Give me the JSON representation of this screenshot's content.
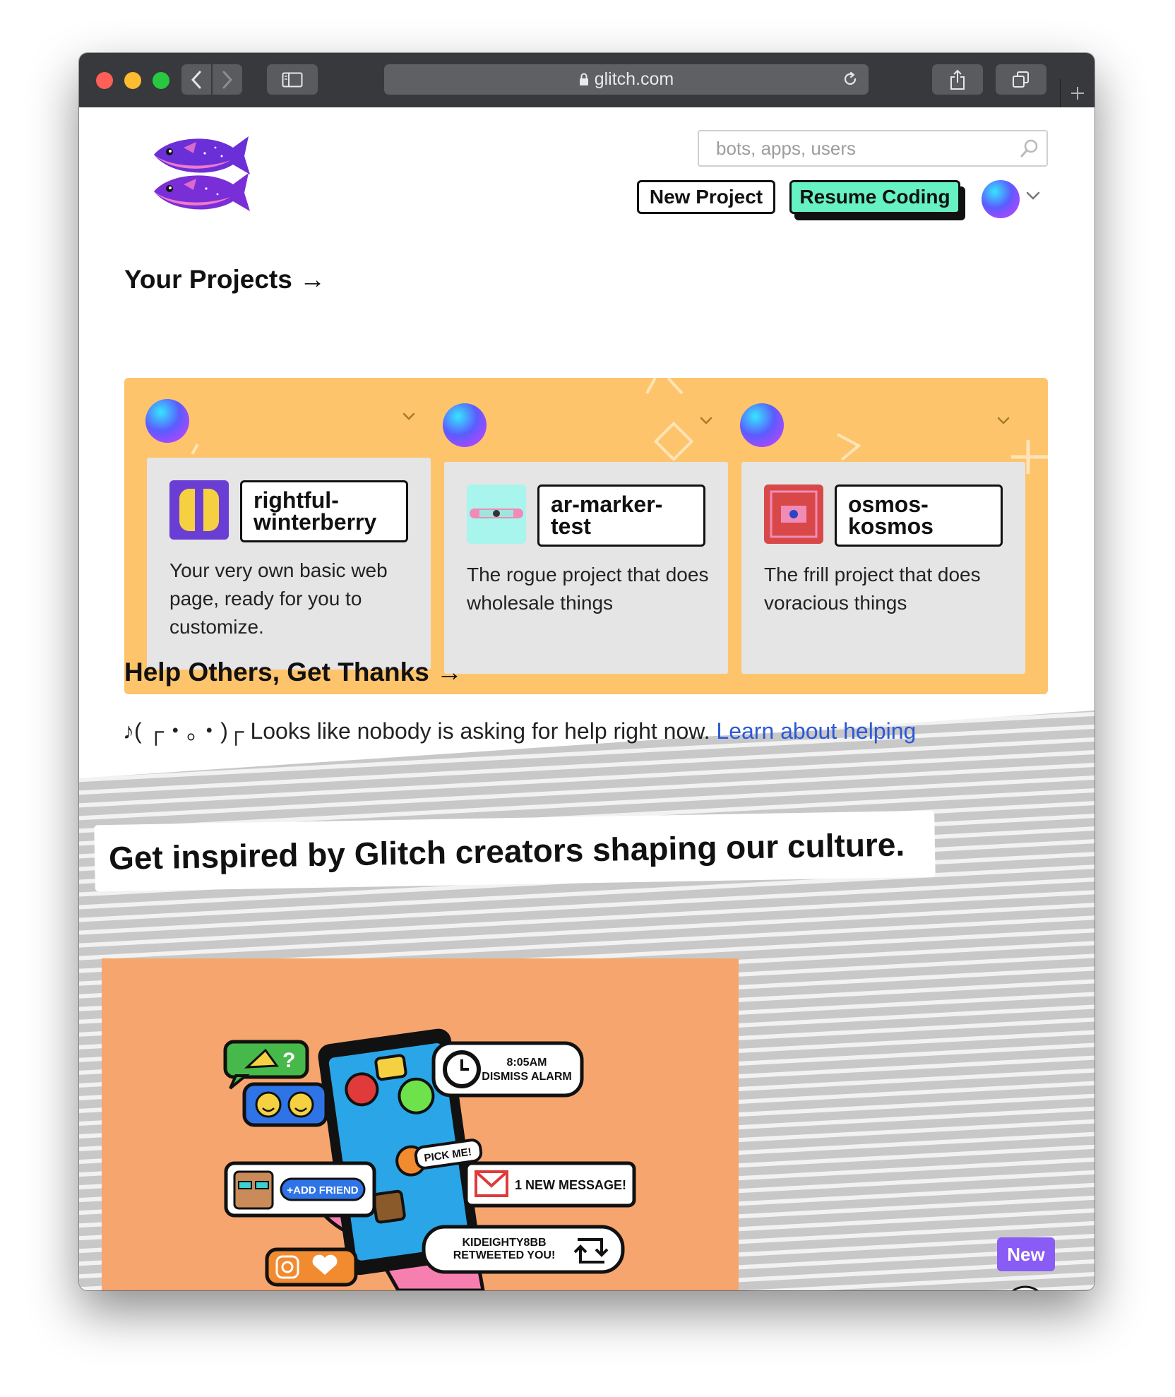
{
  "browser": {
    "url": "glitch.com"
  },
  "header": {
    "search_placeholder": "bots, apps, users",
    "new_project_label": "New Project",
    "resume_coding_label": "Resume Coding"
  },
  "projects_section": {
    "title": "Your Projects →",
    "cards": [
      {
        "name_line1": "rightful-",
        "name_line2": "winterberry",
        "description": "Your very own basic web page, ready for you to customize."
      },
      {
        "name_line1": "ar-marker-",
        "name_line2": "test",
        "description": "The rogue project that does wholesale things"
      },
      {
        "name_line1": "osmos-",
        "name_line2": "kosmos",
        "description": "The frill project that does voracious things"
      }
    ]
  },
  "help_section": {
    "title": "Help Others, Get Thanks →",
    "message": "♪( ┌・。・)┌ Looks like nobody is asking for help right now.",
    "link_label": "Learn about helping"
  },
  "culture_section": {
    "title": "Get inspired by Glitch creators shaping our culture."
  },
  "illustration": {
    "alarm_time": "8:05AM",
    "alarm_action": "DISMISS ALARM",
    "pick_me": "PICK ME!",
    "add_friend": "+ADD FRIEND",
    "new_message": "1 NEW MESSAGE!",
    "retweet_line1": "KIDEIGHTY8BB",
    "retweet_line2": "RETWEETED YOU!"
  },
  "new_badge": "New",
  "colors": {
    "toolbar": "#38393c",
    "resume_button": "#66f2c2",
    "projects_background": "#fec46b",
    "card_background": "#e5e5e5",
    "link": "#2c59d6",
    "hero_background": "#f6a56e",
    "new_badge": "#8a5cf6"
  }
}
